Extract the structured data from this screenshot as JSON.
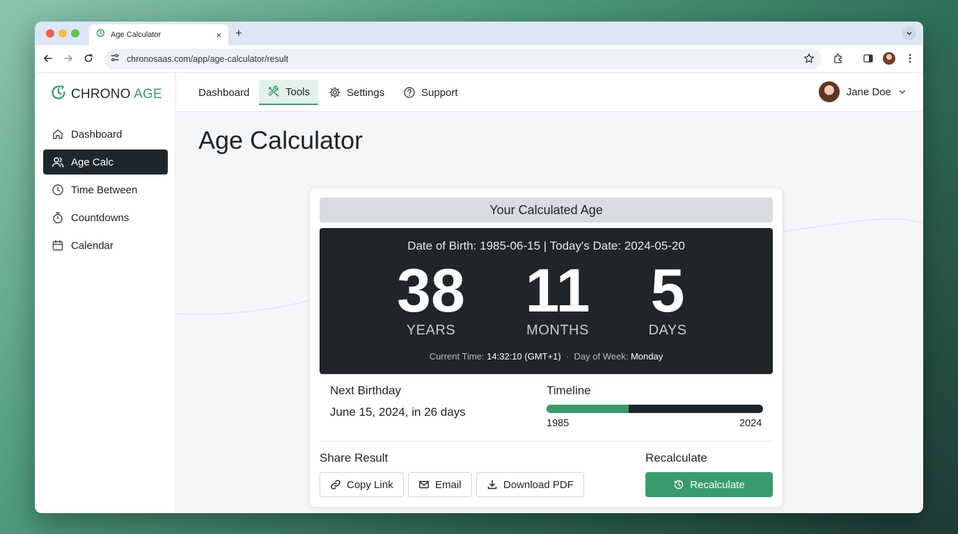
{
  "browser": {
    "tab_title": "Age Calculator",
    "tab_close": "×",
    "new_tab": "+",
    "url": "chronosaas.com/app/age-calculator/result"
  },
  "brand": {
    "name_part1": "CHRONO",
    "name_part2": "AGE",
    "accent": "#3a9a6c"
  },
  "sidebar": {
    "items": [
      {
        "label": "Dashboard",
        "icon": "home-icon"
      },
      {
        "label": "Age Calc",
        "icon": "users-icon",
        "active": true
      },
      {
        "label": "Time Between",
        "icon": "clock-icon"
      },
      {
        "label": "Countdowns",
        "icon": "stopwatch-icon"
      },
      {
        "label": "Calendar",
        "icon": "calendar-icon"
      }
    ]
  },
  "topnav": {
    "tabs": [
      {
        "label": "Dashboard"
      },
      {
        "label": "Tools",
        "icon": "tools-icon",
        "active": true
      },
      {
        "label": "Settings",
        "icon": "gear-icon"
      },
      {
        "label": "Support",
        "icon": "help-icon"
      }
    ],
    "user_name": "Jane Doe"
  },
  "main": {
    "title": "Age Calculator",
    "card": {
      "header": "Your Calculated Age",
      "dates_line": "Date of Birth: 1985-06-15  |  Today's Date: 2024-05-20",
      "years": {
        "value": "38",
        "unit": "YEARS"
      },
      "months": {
        "value": "11",
        "unit": "MONTHS"
      },
      "days": {
        "value": "5",
        "unit": "DAYS"
      },
      "current_time_label": "Current Time:",
      "current_time_value": "14:32:10 (GMT+1)",
      "separator": "·",
      "day_of_week_label": "Day of Week:",
      "day_of_week_value": "Monday",
      "next_birthday": {
        "label": "Next Birthday",
        "value": "June 15, 2024, in 26 days"
      },
      "timeline": {
        "label": "Timeline",
        "start": "1985",
        "end": "2024",
        "progress_fraction": 0.38
      },
      "share": {
        "label": "Share Result",
        "copy_link": "Copy Link",
        "email": "Email",
        "download_pdf": "Download PDF"
      },
      "recalc": {
        "label": "Recalculate",
        "button": "Recalculate"
      }
    }
  }
}
